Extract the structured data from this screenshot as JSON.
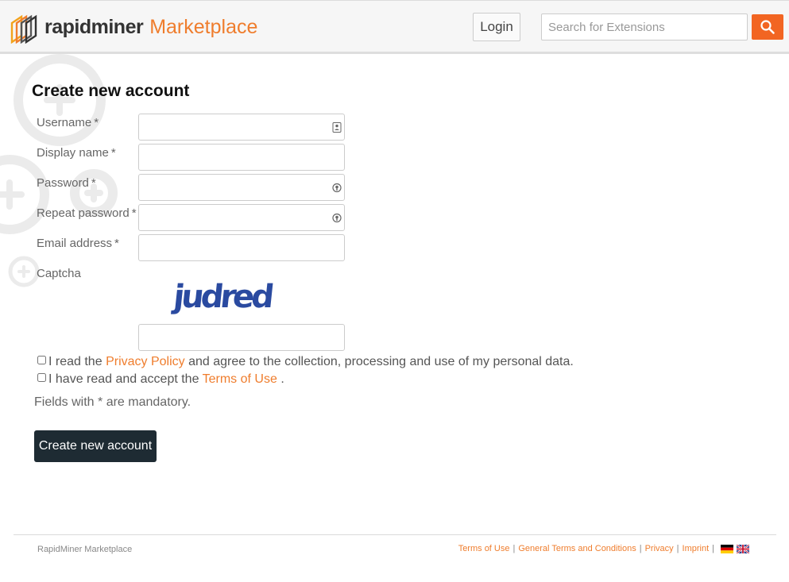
{
  "header": {
    "brand_name": "rapidminer",
    "brand_suffix": "Marketplace",
    "login_label": "Login",
    "search_placeholder": "Search for Extensions",
    "search_icon": "magnifier-icon"
  },
  "form": {
    "title": "Create new account",
    "required_marker": "*",
    "fields": [
      {
        "label": "Username",
        "required": true,
        "value": ""
      },
      {
        "label": "Display name",
        "required": true,
        "value": ""
      },
      {
        "label": "Password",
        "required": true,
        "value": ""
      },
      {
        "label": "Repeat password",
        "required": true,
        "value": ""
      },
      {
        "label": "Email address",
        "required": true,
        "value": ""
      }
    ],
    "captcha_label": "Captcha",
    "captcha_text": "judred",
    "captcha_value": "",
    "privacy_check": {
      "prefix": "I read the",
      "link": "Privacy Policy",
      "suffix": "and agree to the collection, processing and use of my personal data.",
      "checked": false
    },
    "terms_check": {
      "prefix": "I have read and accept the",
      "link": "Terms of Use",
      "suffix": ".",
      "checked": false
    },
    "mandatory_note": "Fields with * are mandatory.",
    "submit_label": "Create new account"
  },
  "footer": {
    "brand": "RapidMiner Marketplace",
    "links": [
      "Terms of Use",
      "General Terms and Conditions",
      "Privacy",
      "Imprint"
    ],
    "separator": "|",
    "languages": [
      "german-flag-icon",
      "uk-flag-icon"
    ]
  },
  "colors": {
    "accent": "#ef7d2d",
    "search_button": "#f26522",
    "submit_button": "#1e2b33"
  }
}
